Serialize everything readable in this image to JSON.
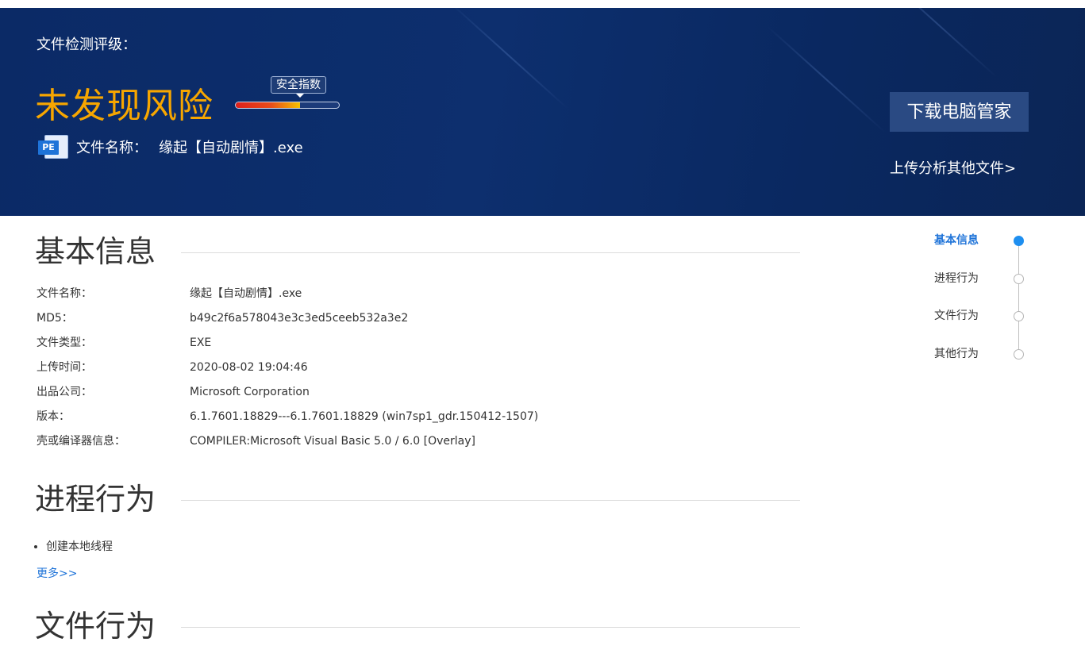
{
  "hero": {
    "title": "文件检测评级：",
    "risk_level": "未发现风险",
    "score_label": "安全指数",
    "score_fraction": 0.62,
    "file_type_badge": "PE",
    "file_name_label": "文件名称：",
    "file_name": "缘起【自动剧情】.exe",
    "download_label": "下载电脑管家",
    "upload_label": "上传分析其他文件>"
  },
  "basic_info": {
    "heading": "基本信息",
    "rows": [
      {
        "key": "文件名称：",
        "value": "缘起【自动剧情】.exe"
      },
      {
        "key": "MD5：",
        "value": "b49c2f6a578043e3c3ed5ceeb532a3e2"
      },
      {
        "key": "文件类型：",
        "value": "EXE"
      },
      {
        "key": "上传时间：",
        "value": "2020-08-02 19:04:46"
      },
      {
        "key": "出品公司：",
        "value": "Microsoft Corporation"
      },
      {
        "key": "版本：",
        "value": "6.1.7601.18829---6.1.7601.18829 (win7sp1_gdr.150412-1507)"
      },
      {
        "key": "壳或编译器信息：",
        "value": "COMPILER:Microsoft Visual Basic 5.0 / 6.0 [Overlay]"
      }
    ]
  },
  "process_behavior": {
    "heading": "进程行为",
    "items": [
      "创建本地线程"
    ],
    "more_label": "更多>>"
  },
  "file_behavior": {
    "heading": "文件行为"
  },
  "side_nav": {
    "items": [
      {
        "label": "基本信息",
        "active": true
      },
      {
        "label": "进程行为",
        "active": false
      },
      {
        "label": "文件行为",
        "active": false
      },
      {
        "label": "其他行为",
        "active": false
      }
    ]
  },
  "colors": {
    "hero_bg": "#0b2a66",
    "risk_text": "#f7a600",
    "accent": "#1e73d8",
    "nav_active_dot": "#1e8ff0"
  }
}
